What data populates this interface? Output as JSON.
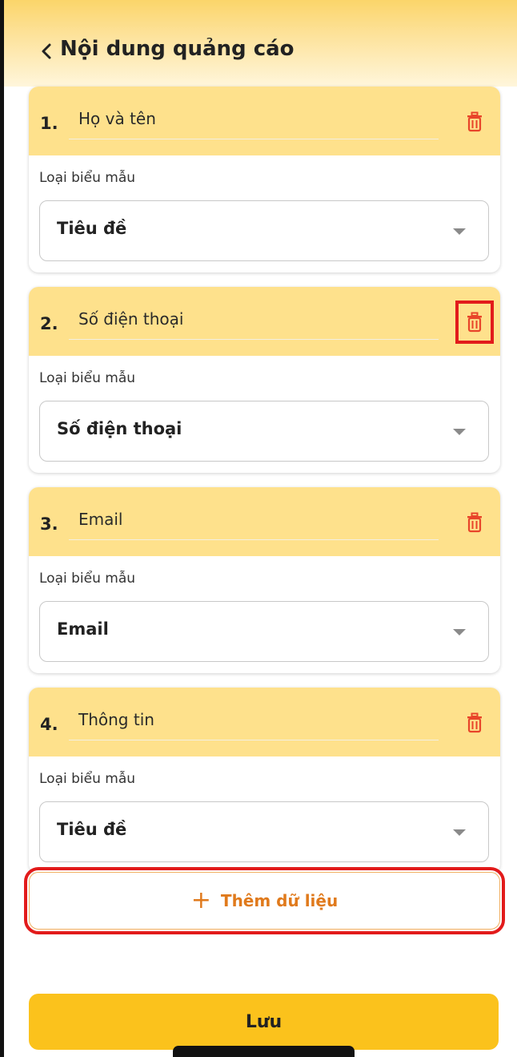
{
  "header": {
    "title": "Nội dung quảng cáo",
    "back_icon": "chevron-left-icon"
  },
  "items": [
    {
      "index": "1.",
      "field_value": "Họ và tên",
      "type_label": "Loại biểu mẫu",
      "type_value": "Tiêu đề",
      "trash_highlighted": false
    },
    {
      "index": "2.",
      "field_value": "Số điện thoại",
      "type_label": "Loại biểu mẫu",
      "type_value": "Số điện thoại",
      "trash_highlighted": true
    },
    {
      "index": "3.",
      "field_value": "Email",
      "type_label": "Loại biểu mẫu",
      "type_value": "Email",
      "trash_highlighted": false
    },
    {
      "index": "4.",
      "field_value": "Thông tin",
      "type_label": "Loại biểu mẫu",
      "type_value": "Tiêu đề",
      "trash_highlighted": false
    }
  ],
  "add_button": {
    "icon": "+",
    "label": "Thêm dữ liệu",
    "highlighted": true
  },
  "save_button": {
    "label": "Lưu"
  },
  "colors": {
    "accent": "#fbc21c",
    "card_header": "#fee18c",
    "delete": "#e8452a",
    "add_text": "#e07a1c",
    "highlight": "#e21b1b"
  }
}
